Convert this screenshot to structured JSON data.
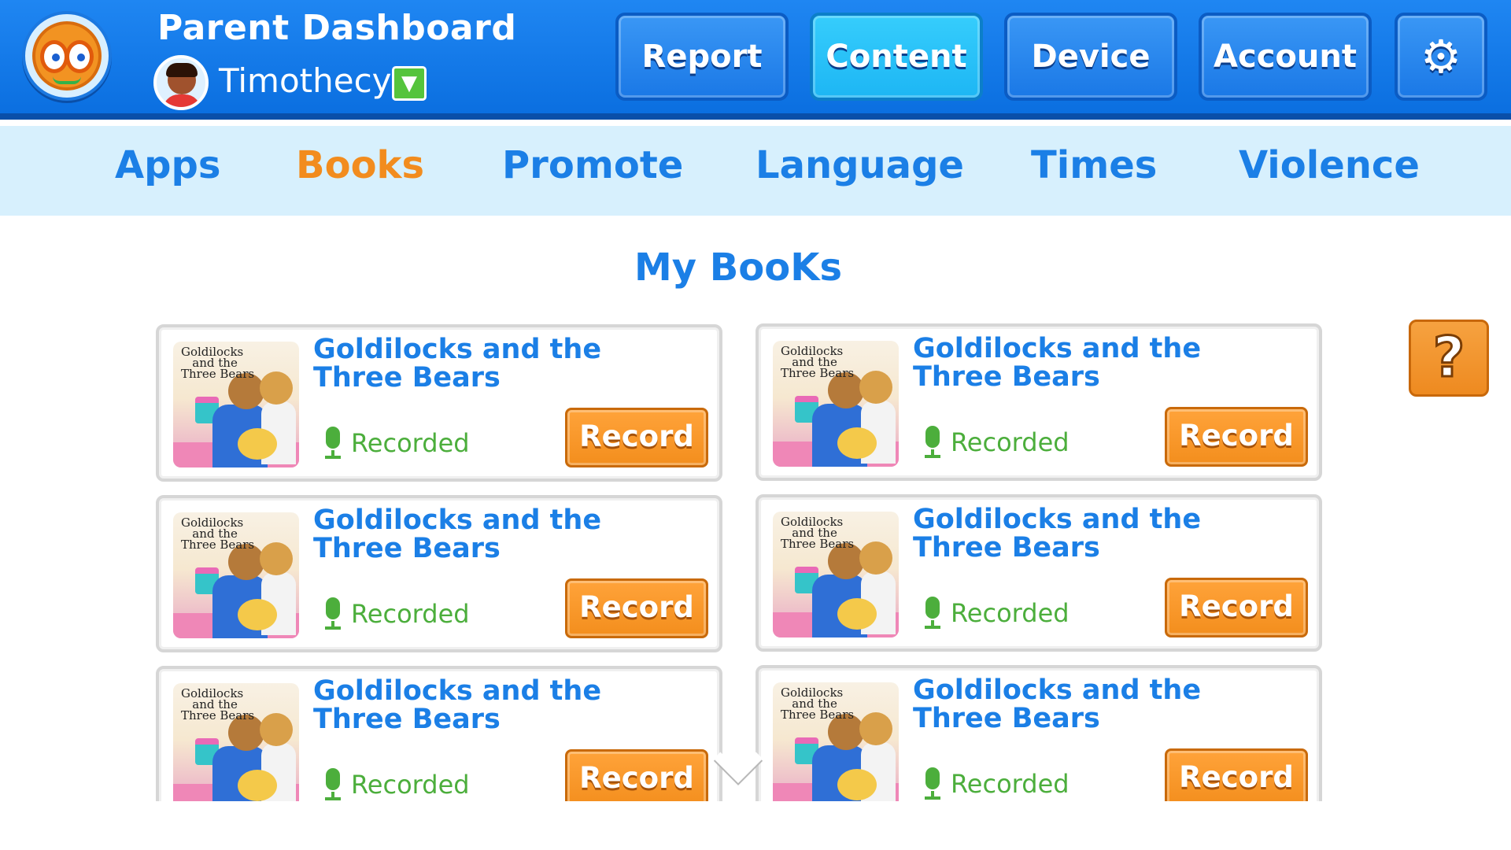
{
  "header": {
    "title": "Parent Dashboard",
    "user": {
      "name": "Timothecy",
      "dropdown_icon": "▼"
    },
    "nav": [
      {
        "label": "Report"
      },
      {
        "label": "Content"
      },
      {
        "label": "Device"
      },
      {
        "label": "Account"
      }
    ],
    "active_nav": "Content",
    "settings_icon": "⚙"
  },
  "subnav": {
    "tabs": [
      {
        "label": "Apps"
      },
      {
        "label": "Books"
      },
      {
        "label": "Promote"
      },
      {
        "label": "Language"
      },
      {
        "label": "Times"
      },
      {
        "label": "Violence"
      }
    ],
    "active_tab": "Books"
  },
  "main": {
    "section_title": "My BooKs",
    "books": [
      {
        "cover_text": "Goldilocks\n   and the\nThree Bears",
        "title": "Goldilocks and the Three Bears",
        "status": "Recorded",
        "action": "Record"
      },
      {
        "cover_text": "Goldilocks\n   and the\nThree Bears",
        "title": "Goldilocks and the Three Bears",
        "status": "Recorded",
        "action": "Record"
      },
      {
        "cover_text": "Goldilocks\n   and the\nThree Bears",
        "title": "Goldilocks and the Three Bears",
        "status": "Recorded",
        "action": "Record"
      },
      {
        "cover_text": "Goldilocks\n   and the\nThree Bears",
        "title": "Goldilocks and the Three Bears",
        "status": "Recorded",
        "action": "Record"
      },
      {
        "cover_text": "Goldilocks\n   and the\nThree Bears",
        "title": "Goldilocks and the Three Bears",
        "status": "Recorded",
        "action": "Record"
      },
      {
        "cover_text": "Goldilocks\n   and the\nThree Bears",
        "title": "Goldilocks and the Three Bears",
        "status": "Recorded",
        "action": "Record"
      }
    ],
    "help_label": "?"
  },
  "colors": {
    "header_blue": "#0b6fe0",
    "subnav_bg": "#d7f0fd",
    "tab_blue": "#1b7fe6",
    "active_orange": "#f28c1e",
    "recorded_green": "#4cae3c",
    "record_button": "#f38e1d",
    "active_nav_cyan": "#1db6f4"
  },
  "icons": [
    "app-logo-icon",
    "user-avatar-icon",
    "dropdown-arrow-icon",
    "gear-icon",
    "microphone-icon",
    "help-icon",
    "chevron-down-icon"
  ]
}
